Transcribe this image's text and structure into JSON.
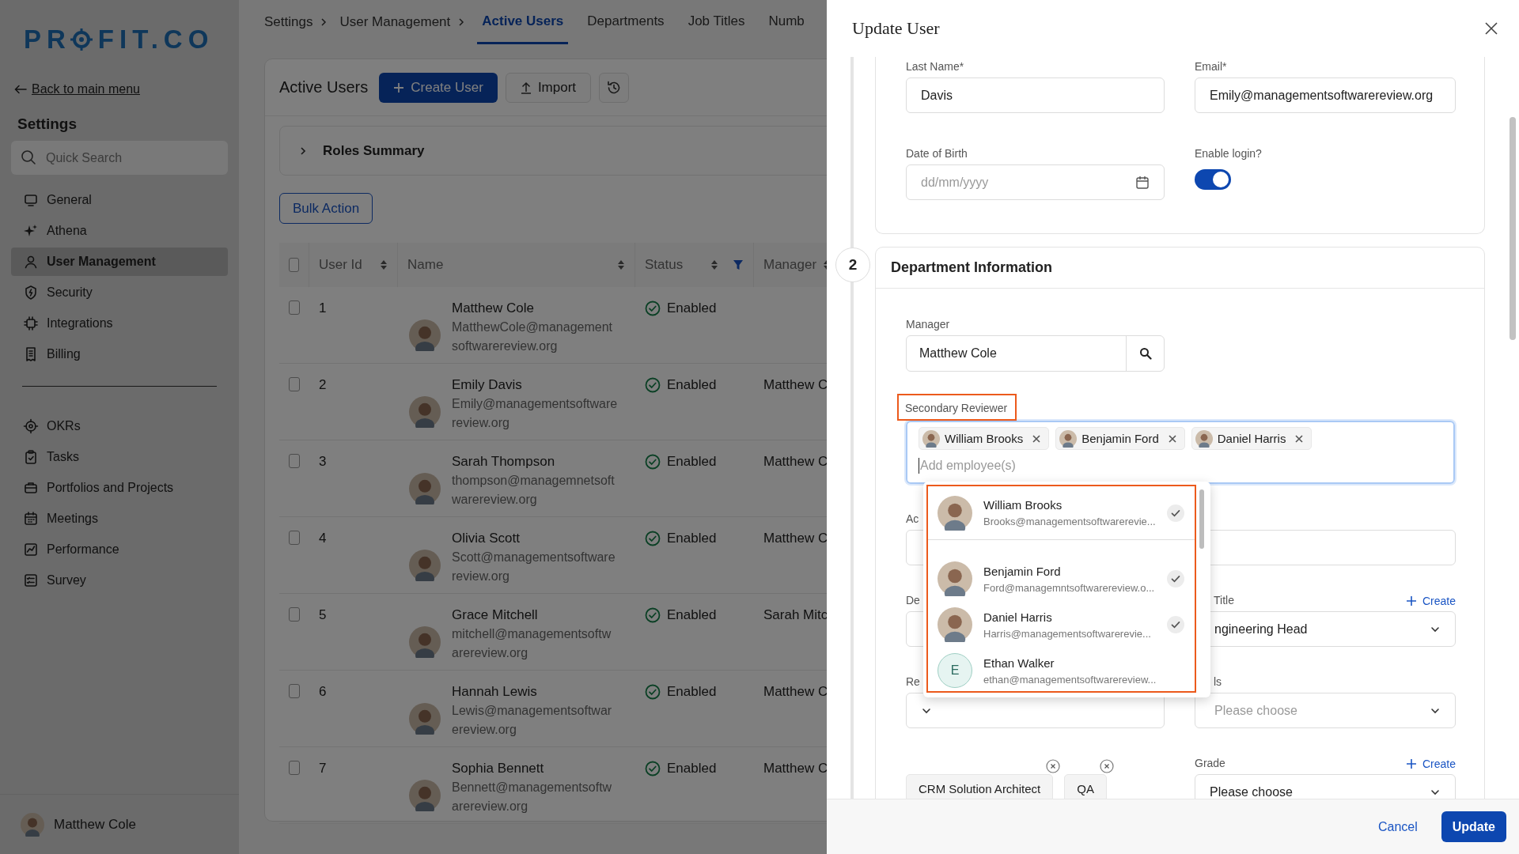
{
  "sidebar": {
    "logo": [
      "PR",
      "FIT.CO"
    ],
    "back_link": "Back to main menu",
    "title": "Settings",
    "search": {
      "placeholder": "Quick Search"
    },
    "groups": [
      [
        {
          "label": "General",
          "selected": false
        },
        {
          "label": "Athena",
          "selected": false
        },
        {
          "label": "User Management",
          "selected": true
        },
        {
          "label": "Security",
          "selected": false
        },
        {
          "label": "Integrations",
          "selected": false
        },
        {
          "label": "Billing",
          "selected": false
        }
      ],
      [
        {
          "label": "OKRs",
          "selected": false
        },
        {
          "label": "Tasks",
          "selected": false
        },
        {
          "label": "Portfolios and Projects",
          "selected": false
        },
        {
          "label": "Meetings",
          "selected": false
        },
        {
          "label": "Performance",
          "selected": false
        },
        {
          "label": "Survey",
          "selected": false
        }
      ]
    ],
    "user": {
      "name": "Matthew Cole"
    }
  },
  "breadcrumb": [
    "Settings",
    "User Management"
  ],
  "tabs": [
    {
      "label": "Active Users",
      "selected": true
    },
    {
      "label": "Departments",
      "selected": false
    },
    {
      "label": "Job Titles",
      "selected": false
    },
    {
      "label": "Numb",
      "selected": false
    }
  ],
  "page": {
    "title": "Active Users",
    "create_button": "Create User",
    "import_button": "Import",
    "roles_summary": "Roles Summary",
    "bulk_action": "Bulk Action"
  },
  "table": {
    "select_all": {
      "checked": false
    },
    "columns": [
      {
        "label": "User Id",
        "sortable": true,
        "filter": false
      },
      {
        "label": "Name",
        "sortable": true,
        "filter": false
      },
      {
        "label": "Status",
        "sortable": true,
        "filter": true
      },
      {
        "label": "Manager",
        "sortable": true,
        "filter": false
      }
    ],
    "rows": [
      {
        "checked": false,
        "id": "1",
        "name": "Matthew Cole",
        "email": "MatthewCole@management softwarereview.org",
        "status": "Enabled"
      },
      {
        "checked": false,
        "id": "2",
        "name": "Emily Davis",
        "email": "Emily@managementsoftware review.org",
        "status": "Enabled",
        "manager": "Matthew C"
      },
      {
        "checked": false,
        "id": "3",
        "name": "Sarah Thompson",
        "email": "thompson@managemnetsoft warereview.org",
        "status": "Enabled",
        "manager": "Matthew C"
      },
      {
        "checked": false,
        "id": "4",
        "name": "Olivia Scott",
        "email": "Scott@managementsoftware review.org",
        "status": "Enabled",
        "manager": "Matthew C"
      },
      {
        "checked": false,
        "id": "5",
        "name": "Grace Mitchell",
        "email": "mitchell@managementsoftw arereview.org",
        "status": "Enabled",
        "manager": "Sarah Mitc"
      },
      {
        "checked": false,
        "id": "6",
        "name": "Hannah Lewis",
        "email": "Lewis@managementsoftwar ereview.org",
        "status": "Enabled",
        "manager": "Matthew C"
      },
      {
        "checked": false,
        "id": "7",
        "name": "Sophia Bennett",
        "email": "Bennett@managementsoftw arereview.org",
        "status": "Enabled",
        "manager": "Matthew C"
      }
    ]
  },
  "panel": {
    "title": "Update User",
    "personal": {
      "fields": [
        {
          "label": "Last Name*",
          "value": "Davis"
        },
        {
          "label": "Email*",
          "value": "Emily@managementsoftwarereview.org"
        }
      ],
      "dob": {
        "label": "Date of Birth",
        "placeholder": "dd/mm/yyyy"
      },
      "enable_login": {
        "label": "Enable login?",
        "on": true
      }
    },
    "department": {
      "step": "2",
      "title": "Department Information",
      "manager": {
        "label": "Manager",
        "value": "Matthew  Cole"
      },
      "secondary_reviewer": {
        "label": "Secondary Reviewer",
        "highlighted": true,
        "tags": [
          {
            "name": "William Brooks"
          },
          {
            "name": "Benjamin Ford"
          },
          {
            "name": "Daniel Harris"
          }
        ],
        "placeholder": "Add employee(s)",
        "options": [
          {
            "name": "William Brooks",
            "email": "Brooks@managementsoftwarerevie...",
            "selected": true
          },
          {
            "name": "Benjamin Ford",
            "email": "Ford@managemntsoftwarereview.o...",
            "selected": true
          },
          {
            "name": "Daniel Harris",
            "email": "Harris@managementsoftwarerevie...",
            "selected": true
          },
          {
            "name": "Ethan Walker",
            "email": "ethan@managementsoftwarereview...",
            "selected": false,
            "initial": "E"
          }
        ]
      },
      "partial_labels": [
        "Ac",
        "De",
        "Re"
      ],
      "job_title": {
        "label": "Title",
        "create": "Create",
        "value": "ngineering Head"
      },
      "levels": {
        "label": "ls",
        "placeholder": "Please choose"
      },
      "chips": [
        "CRM Solution Architect",
        "QA"
      ],
      "grade": {
        "label": "Grade",
        "create": "Create",
        "placeholder": "Please choose"
      }
    },
    "cancel": "Cancel",
    "update": "Update"
  }
}
